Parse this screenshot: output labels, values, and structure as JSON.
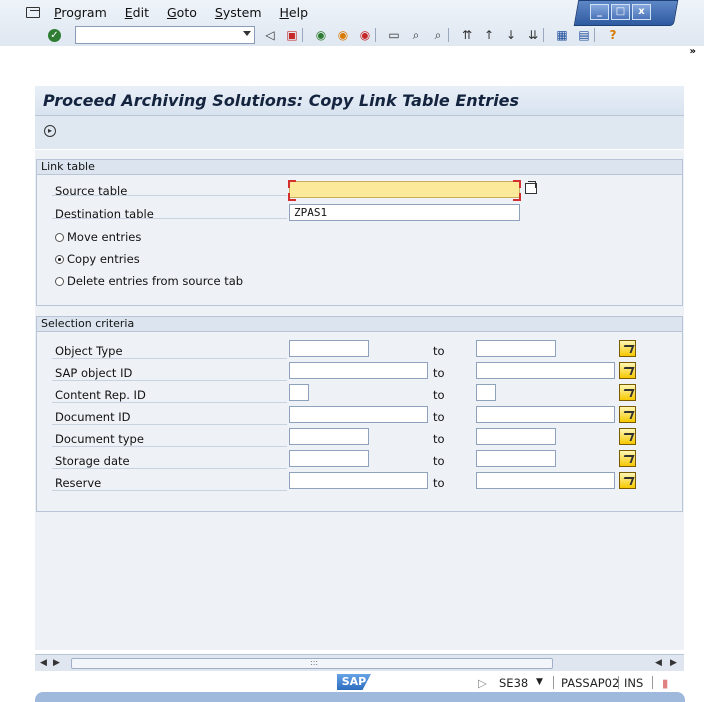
{
  "menu": {
    "items": [
      {
        "label": "Program",
        "u": "P",
        "rest": "rogram"
      },
      {
        "label": "Edit",
        "u": "E",
        "rest": "dit"
      },
      {
        "label": "Goto",
        "u": "G",
        "rest": "oto"
      },
      {
        "label": "System",
        "u": "S",
        "rest": "ystem"
      },
      {
        "label": "Help",
        "u": "H",
        "rest": "elp"
      }
    ]
  },
  "window_controls": {
    "minimize": "_",
    "maximize": "□",
    "close": "x"
  },
  "toolbar": {
    "command_field_value": "",
    "overflow": "»"
  },
  "page": {
    "title": "Proceed Archiving Solutions: Copy Link Table Entries"
  },
  "link_table": {
    "group_title": "Link table",
    "source_label": "Source table",
    "source_value": "",
    "destination_label": "Destination table",
    "destination_value": "ZPAS1",
    "options": [
      {
        "label": "Move entries",
        "selected": false
      },
      {
        "label": "Copy entries",
        "selected": true
      },
      {
        "label": "Delete entries from source tab",
        "selected": false
      }
    ]
  },
  "selection": {
    "group_title": "Selection criteria",
    "to_label": "to",
    "rows": [
      {
        "label": "Object Type",
        "from": "",
        "to": ""
      },
      {
        "label": "SAP object ID",
        "from": "",
        "to": ""
      },
      {
        "label": "Content Rep. ID",
        "from": "",
        "to": ""
      },
      {
        "label": "Document ID",
        "from": "",
        "to": ""
      },
      {
        "label": "Document type",
        "from": "",
        "to": ""
      },
      {
        "label": "Storage date",
        "from": "",
        "to": ""
      },
      {
        "label": "Reserve",
        "from": "",
        "to": ""
      }
    ]
  },
  "status": {
    "logo": "SAP",
    "transaction": "SE38",
    "server": "PASSAP02",
    "mode": "INS"
  },
  "colors": {
    "required_field": "#fde99a",
    "title_text": "#14243f",
    "panel_bg": "#eef2f7"
  }
}
